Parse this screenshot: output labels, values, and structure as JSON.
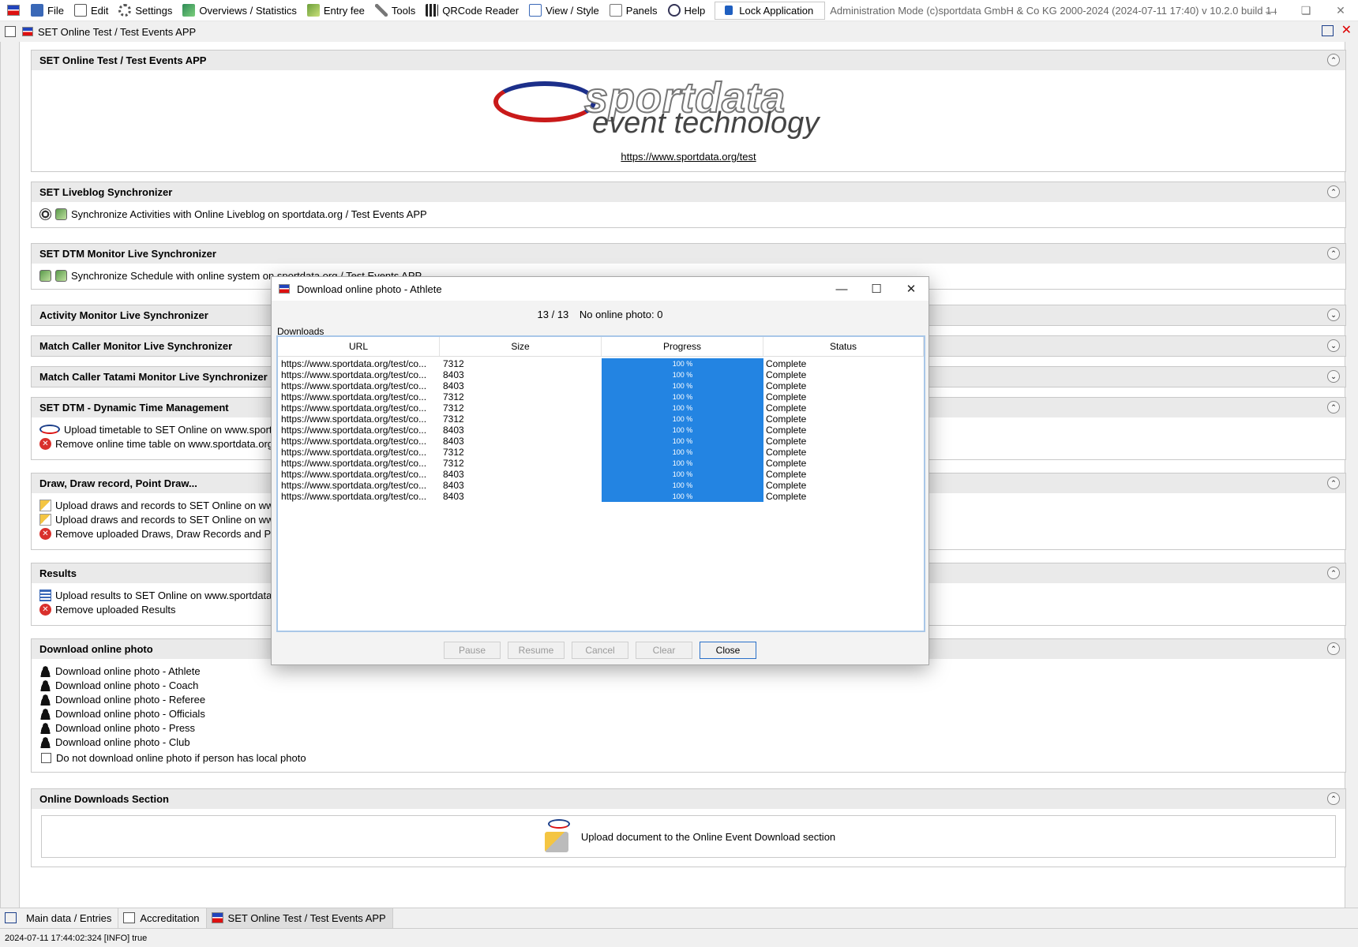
{
  "menubar": {
    "items": [
      "File",
      "Edit",
      "Settings",
      "Overviews / Statistics",
      "Entry fee",
      "Tools",
      "QRCode Reader",
      "View / Style",
      "Panels",
      "Help"
    ],
    "lock_label": "Lock Application",
    "admin_text": "Administration Mode (c)sportdata GmbH & Co KG 2000-2024 (2024-07-11 17:40)  v 10.2.0 build 1 (2024-06..."
  },
  "doc_header": {
    "title": "SET Online Test / Test Events APP"
  },
  "panels": {
    "brand": {
      "title": "SET Online Test / Test Events APP",
      "logo_word1": "sportdata",
      "logo_word2": "event technology",
      "link": "https://www.sportdata.org/test"
    },
    "liveblog": {
      "title": "SET Liveblog Synchronizer",
      "rows": [
        "Synchronize Activities with Online Liveblog on sportdata.org / Test Events APP"
      ]
    },
    "dtm_monitor": {
      "title": "SET DTM Monitor Live Synchronizer",
      "rows": [
        "Synchronize Schedule with online system on sportdata.org / Test Events APP"
      ]
    },
    "activity": {
      "title": "Activity Monitor Live Synchronizer"
    },
    "match_caller": {
      "title": "Match Caller Monitor Live Synchronizer"
    },
    "tatami": {
      "title": "Match Caller Tatami Monitor Live Synchronizer"
    },
    "dtm": {
      "title": "SET DTM - Dynamic Time Management",
      "rows": [
        "Upload timetable to SET Online on www.sportdata.org",
        "Remove online time table on www.sportdata.org"
      ]
    },
    "draws": {
      "title": "Draw, Draw record, Point Draw...",
      "rows": [
        "Upload draws and records to SET Online on www.sportdata.org",
        "Upload draws and records to SET Online on www.sportdata.org",
        "Remove uploaded Draws, Draw Records and Point Lists"
      ]
    },
    "results": {
      "title": "Results",
      "rows": [
        "Upload results to SET Online on www.sportdata.org",
        "Remove uploaded Results"
      ]
    },
    "photo": {
      "title": "Download online photo",
      "rows": [
        "Download online photo - Athlete",
        "Download online photo - Coach",
        "Download online photo - Referee",
        "Download online photo - Officials",
        "Download online photo - Press",
        "Download online photo - Club"
      ],
      "checkbox_label": "Do not download online photo if person has local photo"
    },
    "downloads": {
      "title": "Online Downloads Section",
      "upload_label": "Upload document to the Online Event Download section"
    }
  },
  "tabs": [
    "Main data / Entries",
    "Accreditation",
    "SET Online Test / Test Events APP"
  ],
  "statusbar": "2024-07-11 17:44:02:324 [INFO] true",
  "dialog": {
    "title": "Download online photo - Athlete",
    "count": "13 / 13",
    "no_photo": "No online photo: 0",
    "group_label": "Downloads",
    "columns": [
      "URL",
      "Size",
      "Progress",
      "Status"
    ],
    "rows": [
      {
        "url": "https://www.sportdata.org/test/co...",
        "size": "7312",
        "progress": 1.0,
        "progress_label": "100 %",
        "status": "Complete"
      },
      {
        "url": "https://www.sportdata.org/test/co...",
        "size": "8403",
        "progress": 1.0,
        "progress_label": "100 %",
        "status": "Complete"
      },
      {
        "url": "https://www.sportdata.org/test/co...",
        "size": "8403",
        "progress": 1.0,
        "progress_label": "100 %",
        "status": "Complete"
      },
      {
        "url": "https://www.sportdata.org/test/co...",
        "size": "7312",
        "progress": 1.0,
        "progress_label": "100 %",
        "status": "Complete"
      },
      {
        "url": "https://www.sportdata.org/test/co...",
        "size": "7312",
        "progress": 1.0,
        "progress_label": "100 %",
        "status": "Complete"
      },
      {
        "url": "https://www.sportdata.org/test/co...",
        "size": "7312",
        "progress": 1.0,
        "progress_label": "100 %",
        "status": "Complete"
      },
      {
        "url": "https://www.sportdata.org/test/co...",
        "size": "8403",
        "progress": 1.0,
        "progress_label": "100 %",
        "status": "Complete"
      },
      {
        "url": "https://www.sportdata.org/test/co...",
        "size": "8403",
        "progress": 1.0,
        "progress_label": "100 %",
        "status": "Complete"
      },
      {
        "url": "https://www.sportdata.org/test/co...",
        "size": "7312",
        "progress": 1.0,
        "progress_label": "100 %",
        "status": "Complete"
      },
      {
        "url": "https://www.sportdata.org/test/co...",
        "size": "7312",
        "progress": 1.0,
        "progress_label": "100 %",
        "status": "Complete"
      },
      {
        "url": "https://www.sportdata.org/test/co...",
        "size": "8403",
        "progress": 1.0,
        "progress_label": "100 %",
        "status": "Complete"
      },
      {
        "url": "https://www.sportdata.org/test/co...",
        "size": "8403",
        "progress": 1.0,
        "progress_label": "100 %",
        "status": "Complete"
      },
      {
        "url": "https://www.sportdata.org/test/co...",
        "size": "8403",
        "progress": 1.0,
        "progress_label": "100 %",
        "status": "Complete"
      }
    ],
    "buttons": {
      "pause": "Pause",
      "resume": "Resume",
      "cancel": "Cancel",
      "clear": "Clear",
      "close": "Close"
    }
  },
  "colors": {
    "progress_fill": "#2384e2",
    "remove_red": "#d9302c",
    "brand_blue": "#1c2f8a",
    "brand_red": "#c91a1a"
  }
}
